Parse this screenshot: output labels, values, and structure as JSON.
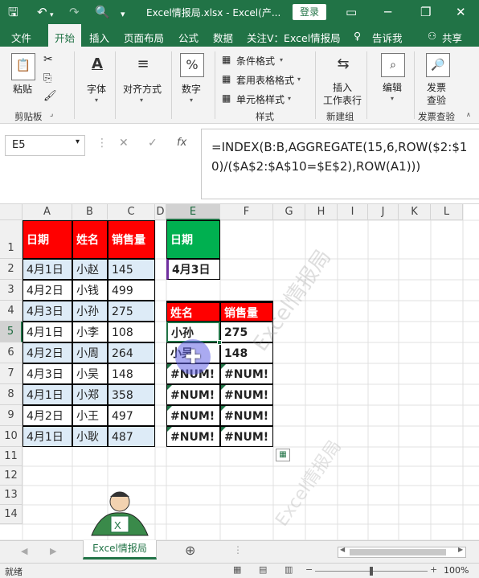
{
  "titlebar": {
    "title": "Excel情报局.xlsx  -  Excel(产...",
    "login": "登录"
  },
  "tabs": [
    "文件",
    "开始",
    "插入",
    "页面布局",
    "公式",
    "数据",
    "关注V：Excel情报局",
    "告诉我",
    "共享"
  ],
  "ribbon": {
    "paste": "粘贴",
    "font": "字体",
    "align": "对齐方式",
    "number": "数字",
    "cond": "条件格式",
    "table": "套用表格格式",
    "cellstyle": "单元格样式",
    "insert_row": "插入",
    "insert_row2": "工作表行",
    "edit": "编辑",
    "invoice": "发票",
    "invoice2": "查验",
    "groups": {
      "clipboard": "剪贴板",
      "styles": "样式",
      "newgroup": "新建组",
      "invoice": "发票查验"
    }
  },
  "formula": {
    "namebox": "E5",
    "text": "=INDEX(B:B,AGGREGATE(15,6,ROW($2:$10)/($A$2:$A$10=$E$2),ROW(A1)))"
  },
  "columns": [
    "A",
    "B",
    "C",
    "D",
    "E",
    "F",
    "G",
    "H",
    "I",
    "J",
    "K",
    "L"
  ],
  "rows": [
    "1",
    "2",
    "3",
    "4",
    "5",
    "6",
    "7",
    "8",
    "9",
    "10",
    "11",
    "12",
    "13",
    "14"
  ],
  "table_left": {
    "headers": [
      "日期",
      "姓名",
      "销售量"
    ],
    "rows": [
      [
        "4月1日",
        "小赵",
        "145"
      ],
      [
        "4月2日",
        "小钱",
        "499"
      ],
      [
        "4月3日",
        "小孙",
        "275"
      ],
      [
        "4月1日",
        "小李",
        "108"
      ],
      [
        "4月2日",
        "小周",
        "264"
      ],
      [
        "4月3日",
        "小吴",
        "148"
      ],
      [
        "4月1日",
        "小郑",
        "358"
      ],
      [
        "4月2日",
        "小王",
        "497"
      ],
      [
        "4月1日",
        "小耿",
        "487"
      ]
    ]
  },
  "lookup": {
    "label": "日期",
    "value": "4月3日"
  },
  "table_right": {
    "headers": [
      "姓名",
      "销售量"
    ],
    "rows": [
      [
        "小孙",
        "275"
      ],
      [
        "小吴",
        "148"
      ],
      [
        "#NUM!",
        "#NUM!"
      ],
      [
        "#NUM!",
        "#NUM!"
      ],
      [
        "#NUM!",
        "#NUM!"
      ],
      [
        "#NUM!",
        "#NUM!"
      ]
    ]
  },
  "sheet_tab": "Excel情报局",
  "status": {
    "ready": "就绪",
    "zoom": "100%"
  },
  "watermark": "Excel情报局",
  "colors": {
    "accent": "#217346",
    "red": "#ff0000",
    "green": "#00b050",
    "blue_row": "#ddebf7"
  }
}
